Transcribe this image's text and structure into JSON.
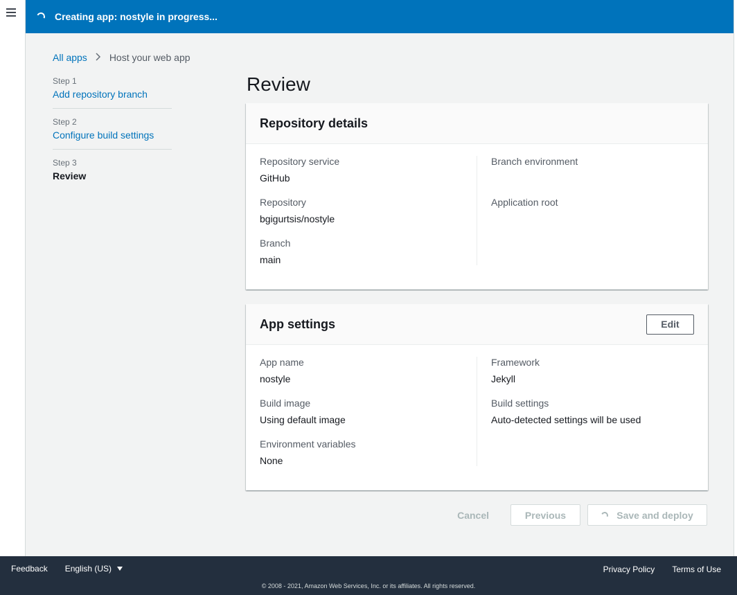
{
  "banner": {
    "message": "Creating app: nostyle in progress..."
  },
  "breadcrumb": {
    "root": "All apps",
    "separator": ">",
    "current": "Host your web app"
  },
  "steps": [
    {
      "number": "Step 1",
      "label": "Add repository branch"
    },
    {
      "number": "Step 2",
      "label": "Configure build settings"
    },
    {
      "number": "Step 3",
      "label": "Review"
    }
  ],
  "page": {
    "title": "Review"
  },
  "repository_details": {
    "title": "Repository details",
    "left": [
      {
        "label": "Repository service",
        "value": "GitHub"
      },
      {
        "label": "Repository",
        "value": "bgigurtsis/nostyle"
      },
      {
        "label": "Branch",
        "value": "main"
      }
    ],
    "right": [
      {
        "label": "Branch environment",
        "value": ""
      },
      {
        "label": "Application root",
        "value": ""
      }
    ]
  },
  "app_settings": {
    "title": "App settings",
    "edit_label": "Edit",
    "left": [
      {
        "label": "App name",
        "value": "nostyle"
      },
      {
        "label": "Build image",
        "value": "Using default image"
      },
      {
        "label": "Environment variables",
        "value": "None"
      }
    ],
    "right": [
      {
        "label": "Framework",
        "value": "Jekyll"
      },
      {
        "label": "Build settings",
        "value": "Auto-detected settings will be used"
      }
    ]
  },
  "actions": {
    "cancel": "Cancel",
    "previous": "Previous",
    "save": "Save and deploy"
  },
  "footer": {
    "feedback": "Feedback",
    "language": "English (US)",
    "privacy": "Privacy Policy",
    "terms": "Terms of Use",
    "copyright": "© 2008 - 2021, Amazon Web Services, Inc. or its affiliates. All rights reserved."
  },
  "colors": {
    "accent": "#0073bb",
    "footer_bg": "#232f3e",
    "page_bg": "#f2f3f3"
  }
}
